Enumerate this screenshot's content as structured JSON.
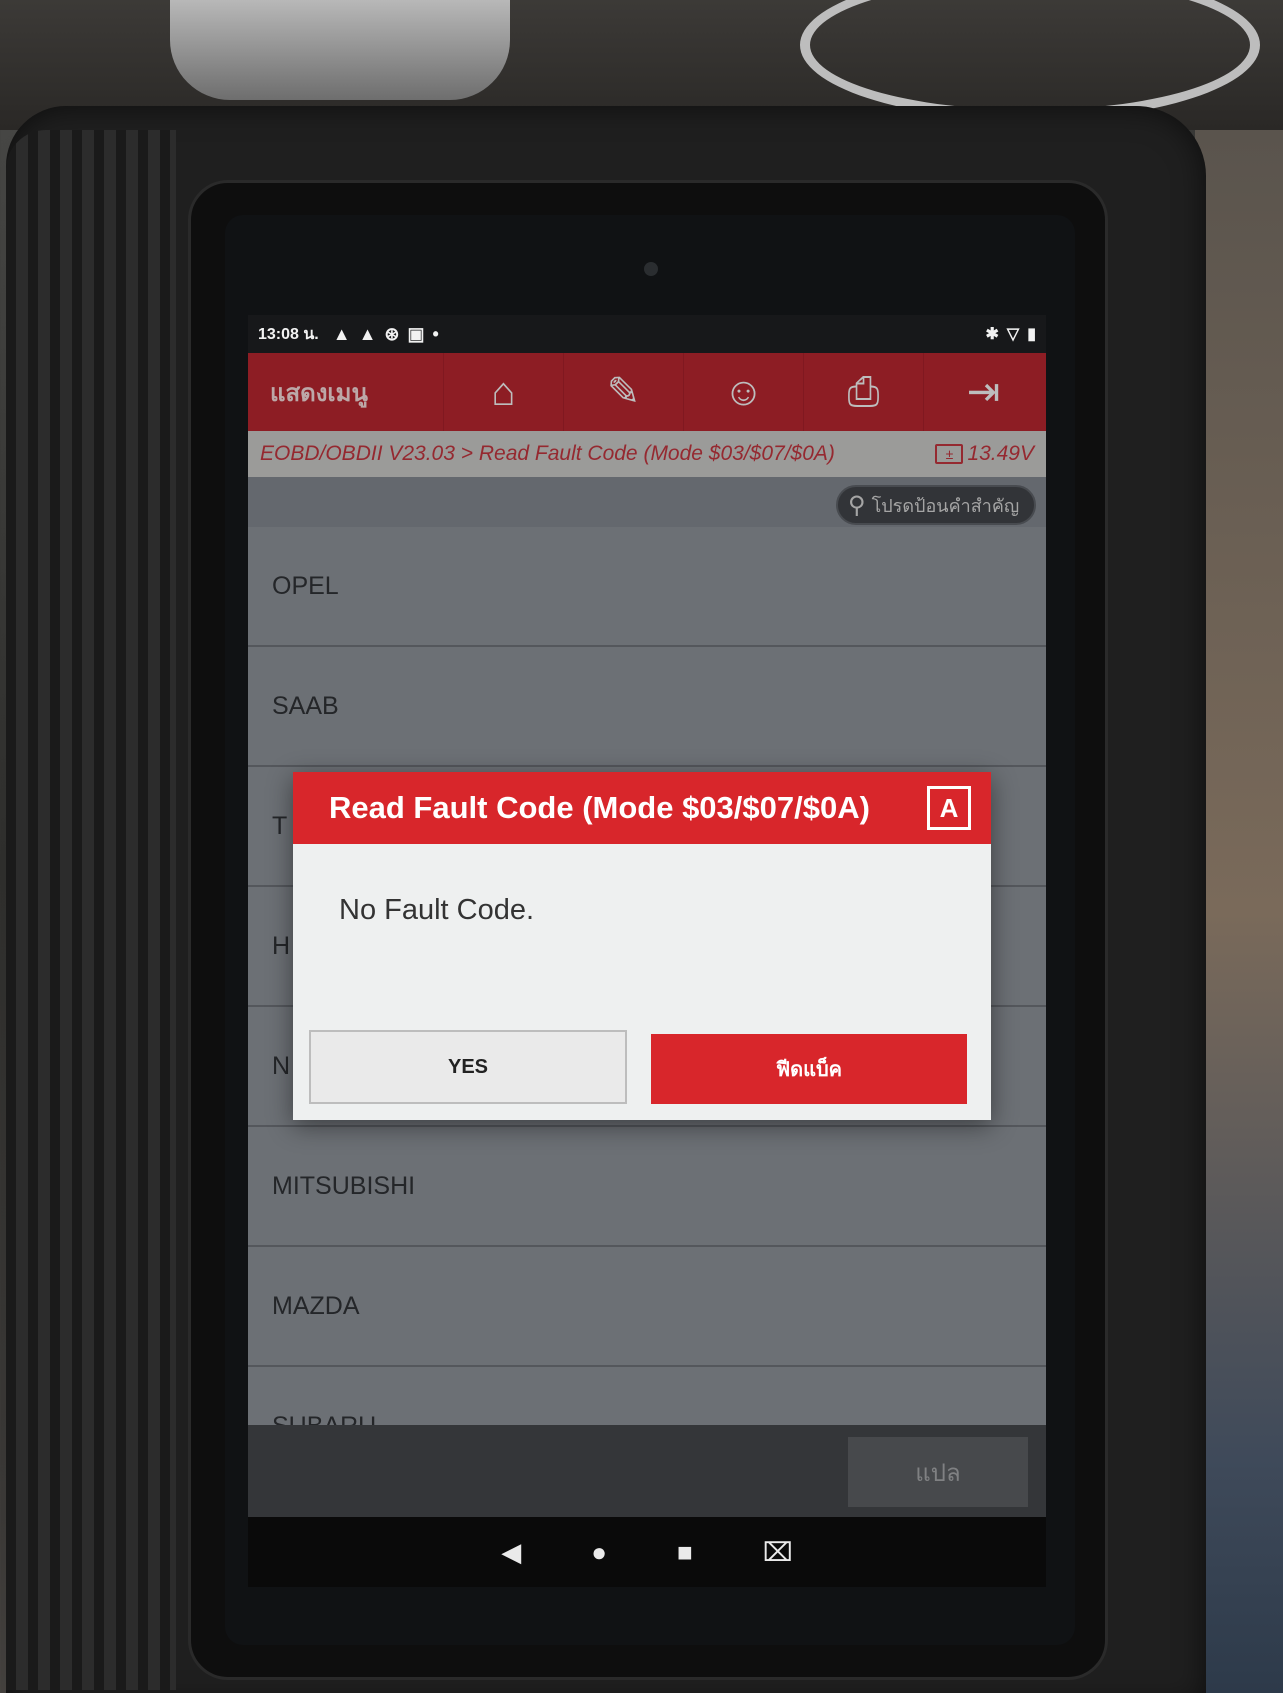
{
  "statusbar": {
    "time": "13:08 น.",
    "left_icons": [
      "▲",
      "▲",
      "⊛",
      "▣",
      "•"
    ],
    "right_icons": [
      "✱",
      "▽",
      "▮"
    ]
  },
  "toolbar": {
    "menu_label": "แสดงเมนู",
    "buttons": [
      {
        "name": "home-icon",
        "glyph": "⌂"
      },
      {
        "name": "edit-report-icon",
        "glyph": "✎"
      },
      {
        "name": "support-icon",
        "glyph": "☺"
      },
      {
        "name": "print-icon",
        "glyph": "⎙"
      },
      {
        "name": "exit-icon",
        "glyph": "⇥"
      }
    ]
  },
  "breadcrumb": {
    "path": "EOBD/OBDII V23.03 > Read Fault Code (Mode $03/$07/$0A)",
    "battery_glyph": "±",
    "voltage": "13.49V"
  },
  "search": {
    "icon": "⚲",
    "placeholder": "โปรดป้อนคำสำคัญ"
  },
  "list": {
    "items": [
      "OPEL",
      "SAAB",
      "T",
      "H",
      "N",
      "MITSUBISHI",
      "MAZDA",
      "SUBARU"
    ]
  },
  "bottom": {
    "translate_label": "แปล"
  },
  "navbar": {
    "back": "◀",
    "home": "●",
    "recents": "■",
    "screenshot": "⌧"
  },
  "dialog": {
    "title": "Read Fault Code (Mode $03/$07/$0A)",
    "help_glyph": "A",
    "message": "No Fault Code.",
    "yes_label": "YES",
    "feedback_label": "ฟีดแบ็ค"
  },
  "colors": {
    "brand_red": "#b6202a",
    "dialog_red": "#d8262b"
  }
}
